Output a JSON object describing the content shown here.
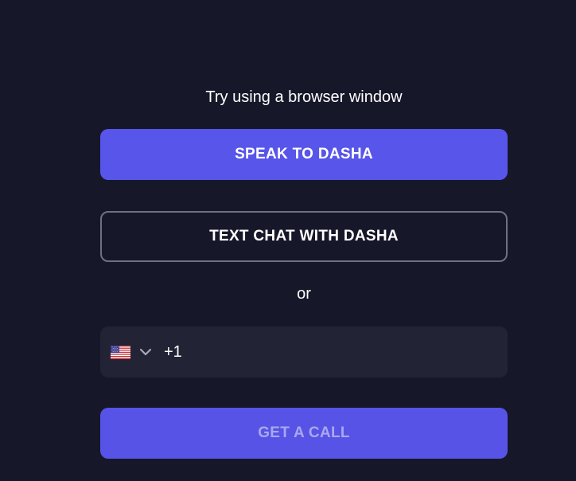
{
  "hint_text": "Try using a browser window",
  "speak_button": {
    "label": "SPEAK TO DASHA"
  },
  "text_chat_button": {
    "label": "TEXT CHAT WITH DASHA"
  },
  "separator_text": "or",
  "phone_field": {
    "country_flag": "us-flag-icon",
    "dropdown_icon": "chevron-down-icon",
    "dial_code": "+1",
    "value": "",
    "placeholder": ""
  },
  "call_button": {
    "label": "GET A CALL",
    "enabled": false
  },
  "colors": {
    "background": "#161729",
    "accent": "#5855ea",
    "input_background": "#222435",
    "outline": "#6f7080",
    "disabled_text": "#a9a8ee"
  }
}
